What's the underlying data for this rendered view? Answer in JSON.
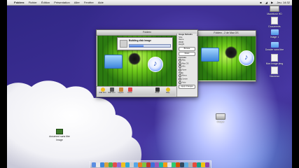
{
  "menubar": {
    "app_name": "Folderx",
    "items": [
      "Fichier",
      "Édition",
      "Présentation",
      "Aller",
      "Fenêtre",
      "Aide"
    ],
    "status": [
      "■",
      "◢",
      "▶",
      "Jeu. 14:32"
    ]
  },
  "desktop_icons": [
    {
      "label": "Macintosh HD",
      "icon": "hard-disk-icon"
    },
    {
      "label": "Documents",
      "icon": "document-icon"
    },
    {
      "label": "Image 1",
      "icon": "folder-icon"
    },
    {
      "label": "Dossier sans titre",
      "icon": "folder-icon"
    },
    {
      "label": "Mon Image.dmg",
      "icon": "document-icon"
    },
    {
      "label": "Nouveau",
      "icon": "document-icon"
    }
  ],
  "cloud_icon": {
    "label": "document sans titre",
    "label2": "Image"
  },
  "disk_icon": {
    "label": "Disque"
  },
  "main_window": {
    "title": "Folderx"
  },
  "second_window": {
    "title": "Folderx - 2 de Mac OS"
  },
  "dialog": {
    "title": "Building disk image",
    "progress": 0.35
  },
  "side_panel": {
    "header": "Image Defaults",
    "fields": [
      "Size",
      "Name",
      "Width",
      "Height"
    ],
    "buttons": [
      "Browse",
      "Reset"
    ],
    "section_label": "Formats",
    "options": [
      "Mac",
      "Mac OS",
      "Win",
      "None"
    ],
    "section_label2": "Style",
    "options2": [
      "Mirror",
      "Center",
      "Auto"
    ],
    "footer": "Apply Changes"
  },
  "toolbar": {
    "items": [
      {
        "label": "Add Icon",
        "icon": "add-icon"
      },
      {
        "label": "Edit Icon",
        "icon": "edit-icon"
      },
      {
        "label": "Layout",
        "icon": "layout-icon"
      },
      {
        "label": "Icons",
        "icon": "icons-icon"
      },
      {
        "label": "Build",
        "icon": "build-icon"
      },
      {
        "label": "Help",
        "icon": "help-icon"
      }
    ]
  },
  "colors": {
    "wallpaper": "#3b2d92",
    "pane_green": "#6ecb1a",
    "window_chrome": "#dcdcdc",
    "close": "#e0443e",
    "minimize": "#dea123",
    "zoom": "#1aab29"
  }
}
